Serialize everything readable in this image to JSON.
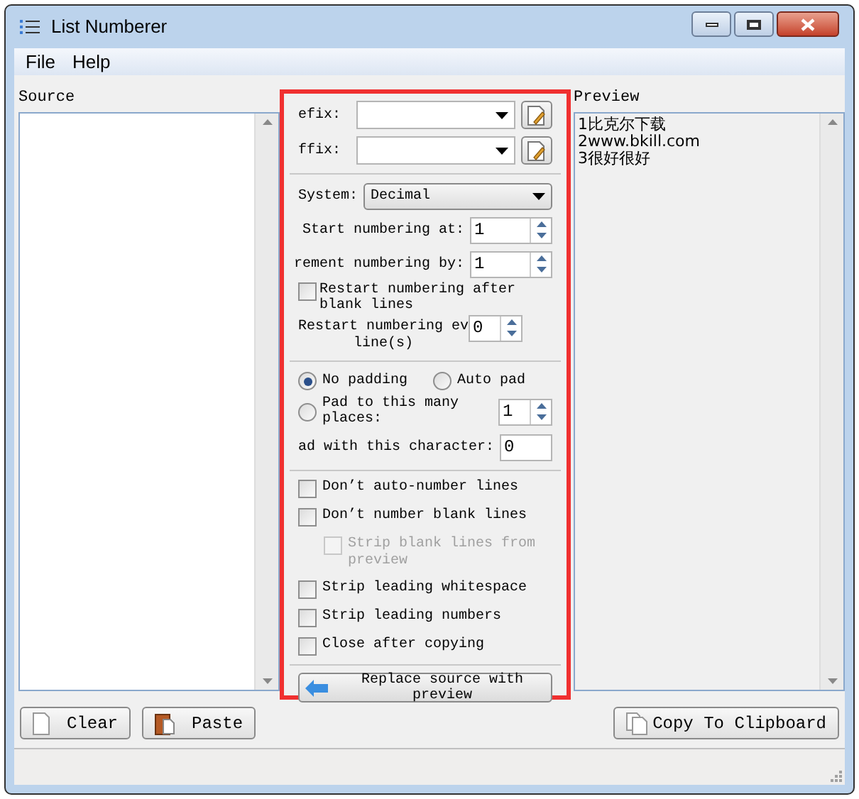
{
  "window": {
    "title": "List Numberer"
  },
  "menu": [
    "File",
    "Help"
  ],
  "source": {
    "label": "Source"
  },
  "options": {
    "prefix": {
      "label": "efix:"
    },
    "suffix": {
      "label": "ffix:"
    },
    "system": {
      "label": "System:",
      "value": "Decimal"
    },
    "start": {
      "label": "Start numbering at:",
      "value": "1"
    },
    "increment": {
      "label": "rement numbering by:",
      "value": "1"
    },
    "restart_blank": {
      "label": "Restart numbering after blank lines",
      "checked": false
    },
    "restart_every": {
      "label": "Restart numbering ev",
      "value": "0",
      "unit": "line(s)"
    },
    "padding": [
      {
        "label": "No padding",
        "selected": true
      },
      {
        "label": "Auto pad",
        "selected": false
      },
      {
        "label": "Pad to this many places:",
        "selected": false,
        "value": "1"
      }
    ],
    "pad_char": {
      "label": "ad with this character:",
      "value": "0"
    },
    "checks": [
      {
        "label": "Don’t auto-number lines",
        "checked": false,
        "disabled": false
      },
      {
        "label": "Don’t number blank lines",
        "checked": false,
        "disabled": false,
        "children": [
          {
            "label": "Strip blank lines from preview",
            "checked": false,
            "disabled": true
          }
        ]
      },
      {
        "label": "Strip leading whitespace",
        "checked": false,
        "disabled": false
      },
      {
        "label": "Strip leading numbers",
        "checked": false,
        "disabled": false
      },
      {
        "label": "Close after copying",
        "checked": false,
        "disabled": false
      }
    ],
    "replace_button": "Replace source with preview"
  },
  "preview": {
    "label": "Preview",
    "lines": [
      "1比克尔下载",
      "2www.bkill.com",
      "3很好很好"
    ]
  },
  "buttons": {
    "clear": "Clear",
    "paste": "Paste",
    "copy": "Copy To Clipboard"
  }
}
